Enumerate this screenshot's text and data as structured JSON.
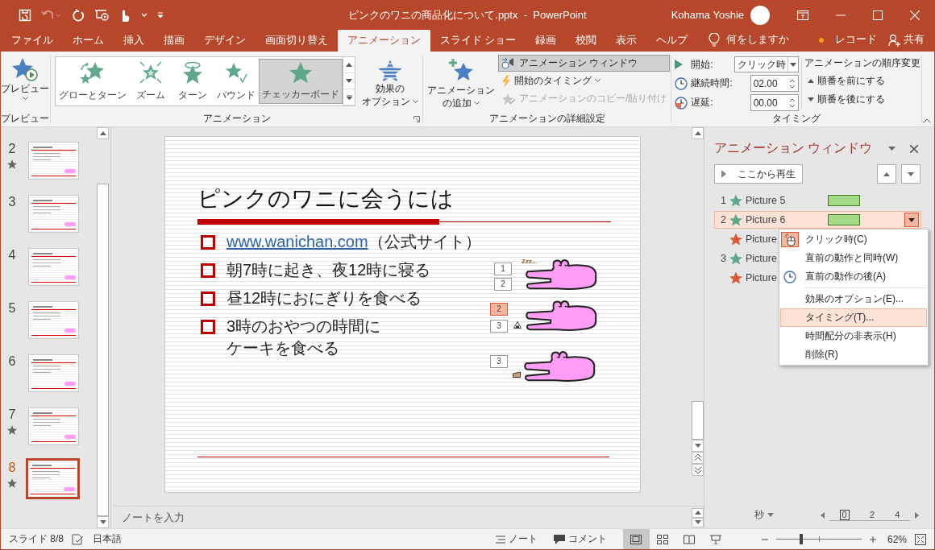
{
  "window": {
    "title": "ピンクのワニの商品化について.pptx  -  PowerPoint",
    "user": "Kohama Yoshie"
  },
  "ribbon_tabs": [
    {
      "label": "ファイル",
      "selected": false
    },
    {
      "label": "ホーム",
      "selected": false
    },
    {
      "label": "挿入",
      "selected": false
    },
    {
      "label": "描画",
      "selected": false
    },
    {
      "label": "デザイン",
      "selected": false
    },
    {
      "label": "画面切り替え",
      "selected": false
    },
    {
      "label": "アニメーション",
      "selected": true
    },
    {
      "label": "スライド ショー",
      "selected": false
    },
    {
      "label": "録画",
      "selected": false
    },
    {
      "label": "校閲",
      "selected": false
    },
    {
      "label": "表示",
      "selected": false
    },
    {
      "label": "ヘルプ",
      "selected": false
    }
  ],
  "tell_me": "何をしますか",
  "record": "レコード",
  "share": "共有",
  "ribbon": {
    "preview": {
      "button": "プレビュー",
      "group": "プレビュー"
    },
    "animation": {
      "group": "アニメーション",
      "effect_options": [
        "効果の",
        "オプション"
      ],
      "gallery": [
        {
          "label": "グローとターン",
          "selected": false
        },
        {
          "label": "ズーム",
          "selected": false
        },
        {
          "label": "ターン",
          "selected": false
        },
        {
          "label": "バウンド",
          "selected": false
        },
        {
          "label": "チェッカーボード",
          "selected": true
        }
      ]
    },
    "advanced": {
      "group": "アニメーションの詳細設定",
      "add": [
        "アニメーション",
        "の追加"
      ],
      "pane": "アニメーション ウィンドウ",
      "pane_on": true,
      "trigger": "開始のタイミング",
      "painter": "アニメーションのコピー/貼り付け",
      "painter_disabled": true
    },
    "timing": {
      "group": "タイミング",
      "start_label": "開始:",
      "start": "クリック時",
      "duration_label": "継続時間:",
      "duration": "02.00",
      "delay_label": "遅延:",
      "delay": "00.00",
      "reorder": "アニメーションの順序変更",
      "earlier": "順番を前にする",
      "later": "順番を後にする"
    }
  },
  "thumbnails": [
    {
      "number": "2",
      "animated": true,
      "selected": false
    },
    {
      "number": "3",
      "animated": false,
      "selected": false
    },
    {
      "number": "4",
      "animated": false,
      "selected": false
    },
    {
      "number": "5",
      "animated": false,
      "selected": false
    },
    {
      "number": "6",
      "animated": false,
      "selected": false
    },
    {
      "number": "7",
      "animated": true,
      "selected": false
    },
    {
      "number": "8",
      "animated": true,
      "selected": true
    }
  ],
  "slide": {
    "title": "ピンクのワニに会うには",
    "bullets": [
      {
        "link": "www.wanichan.com",
        "text": "（公式サイト）"
      },
      {
        "text": "朝7時に起き、夜12時に寝る"
      },
      {
        "text": "昼12時におにぎりを食べる"
      },
      {
        "lines": [
          "3時のおやつの時間に",
          "ケーキを食べる"
        ]
      }
    ],
    "tags": [
      {
        "label": "1",
        "selected": false
      },
      {
        "label": "2",
        "selected": false
      },
      {
        "label": "2",
        "selected": true
      },
      {
        "label": "3",
        "selected": false
      },
      {
        "label": "3",
        "selected": false
      }
    ],
    "sleep_text": "Zzz..."
  },
  "notes_placeholder": "ノートを入力",
  "anim_pane": {
    "title": "アニメーション ウィンドウ",
    "play": "ここから再生",
    "items": [
      {
        "order": "1",
        "name": "Picture 5",
        "kind": "entrance",
        "selected": false
      },
      {
        "order": "2",
        "name": "Picture 6",
        "kind": "entrance",
        "selected": true
      },
      {
        "name": "Picture",
        "kind": "exit",
        "selected": false
      },
      {
        "order": "3",
        "name": "Picture",
        "kind": "entrance",
        "selected": false
      },
      {
        "name": "Picture",
        "kind": "exit",
        "selected": false
      }
    ],
    "unit": "秒",
    "ticks": [
      "0",
      "2",
      "4"
    ]
  },
  "context_menu": {
    "groups": [
      {
        "items": [
          {
            "label": "クリック時(C)",
            "checked": true,
            "selected": false
          },
          {
            "label": "直前の動作と同時(W)",
            "checked": false,
            "selected": false
          },
          {
            "label": "直前の動作の後(A)",
            "checked": false,
            "selected": false
          }
        ]
      },
      {
        "items": [
          {
            "label": "効果のオプション(E)...",
            "selected": false
          },
          {
            "label": "タイミング(T)...",
            "selected": true
          },
          {
            "label": "時間配分の非表示(H)",
            "selected": false
          },
          {
            "label": "削除(R)",
            "selected": false
          }
        ]
      }
    ]
  },
  "status": {
    "slide": "スライド 8/8",
    "language": "日本語",
    "notes": "ノート",
    "comments": "コメント",
    "zoom": "62%",
    "level": 0.29
  }
}
